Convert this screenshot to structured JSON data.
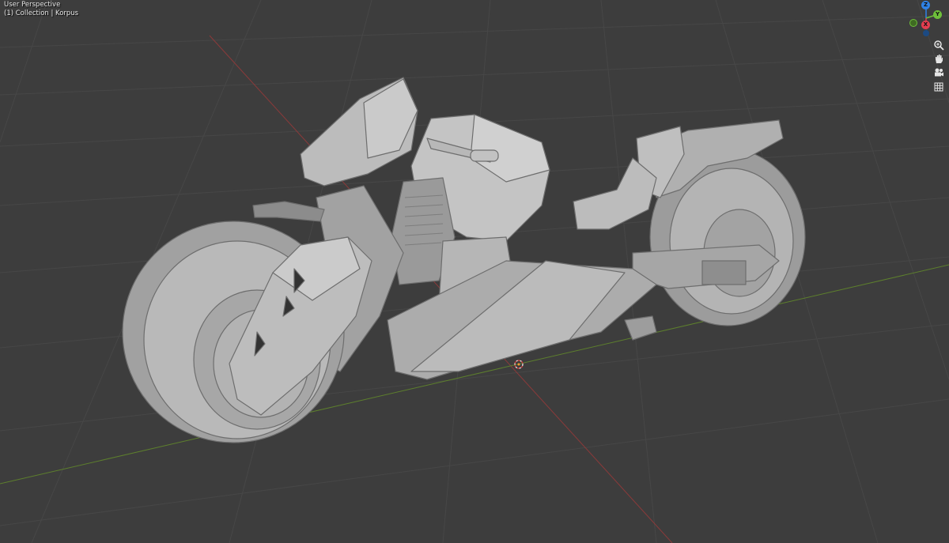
{
  "viewport": {
    "view_name": "User Perspective",
    "collection_line": "(1) Collection | Korpus"
  },
  "gizmo": {
    "z_label": "Z",
    "y_label": "Y",
    "x_label": "X",
    "colors": {
      "x": "#e53d4f",
      "y": "#6ec03a",
      "z": "#2f82e6"
    }
  },
  "navigation_buttons": [
    {
      "icon": "zoom-icon",
      "glyph": "⊕"
    },
    {
      "icon": "pan-hand-icon",
      "glyph": "✋"
    },
    {
      "icon": "camera-view-icon",
      "glyph": "📷"
    },
    {
      "icon": "grid-view-icon",
      "glyph": "▦"
    }
  ],
  "colors": {
    "background": "#3d3d3d",
    "grid": "#474747",
    "x_axis": "#8b3a3a",
    "y_axis": "#5d7f2d",
    "model": "#a8a8a8"
  }
}
